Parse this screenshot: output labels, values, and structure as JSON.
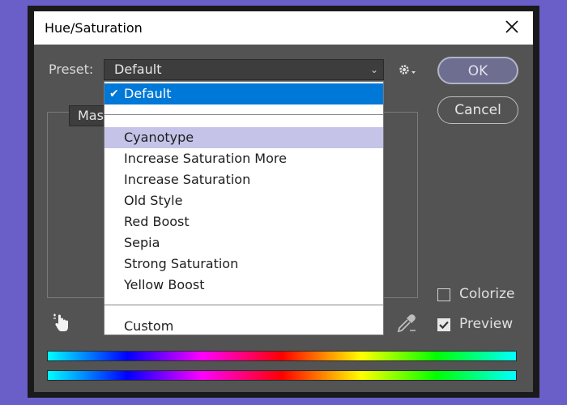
{
  "window": {
    "title": "Hue/Saturation"
  },
  "preset": {
    "label": "Preset:",
    "selected": "Default"
  },
  "buttons": {
    "ok": "OK",
    "cancel": "Cancel"
  },
  "tab": {
    "label": "Master"
  },
  "dropdown": {
    "items": [
      {
        "label": "Default",
        "selected": true
      },
      {
        "label": "Cyanotype",
        "hover": true
      },
      {
        "label": "Increase Saturation More"
      },
      {
        "label": "Increase Saturation"
      },
      {
        "label": "Old Style"
      },
      {
        "label": "Red Boost"
      },
      {
        "label": "Sepia"
      },
      {
        "label": "Strong Saturation"
      },
      {
        "label": "Yellow Boost"
      },
      {
        "label": "Custom"
      }
    ]
  },
  "options": {
    "colorize": {
      "label": "Colorize",
      "checked": false
    },
    "preview": {
      "label": "Preview",
      "checked": true
    }
  },
  "icons": {
    "close": "close-icon",
    "gear": "gear-icon",
    "hand": "targeted-adjustment-hand-icon",
    "eyedropper": "eyedropper-icon",
    "check": "checkmark-icon"
  },
  "colors": {
    "background": "#6a5fc8",
    "panel": "#535353",
    "selection": "#0078d7",
    "hover": "#c5c3e8"
  }
}
